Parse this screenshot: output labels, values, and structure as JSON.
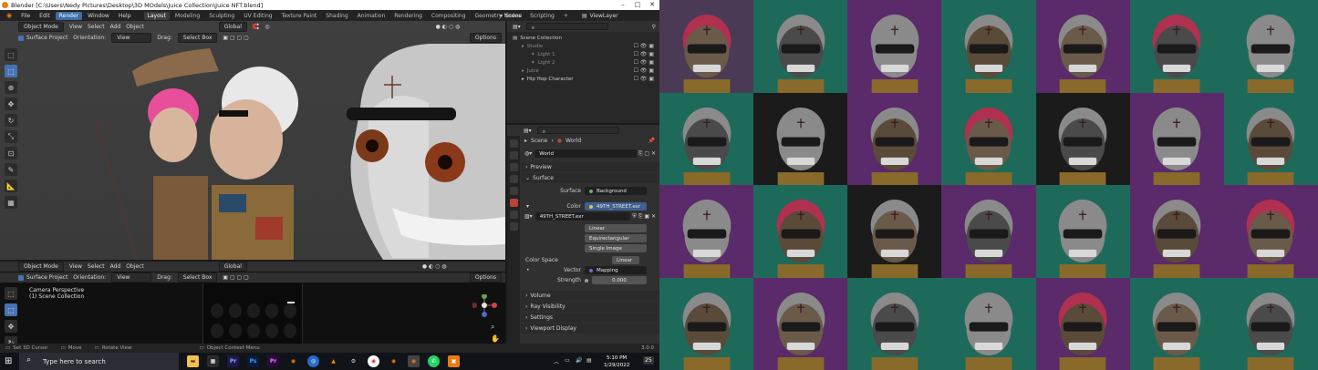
{
  "window": {
    "title": "Blender [C:\\Users\\Nedy Pictures\\Desktop\\3D MOdels\\Juice Collection\\Juice NFT.blend]"
  },
  "menubar": {
    "menus": [
      "File",
      "Edit",
      "Render",
      "Window",
      "Help"
    ],
    "active_menu": "Render",
    "workspaces": [
      "Layout",
      "Modeling",
      "Sculpting",
      "UV Editing",
      "Texture Paint",
      "Shading",
      "Animation",
      "Rendering",
      "Compositing",
      "Geometry Nodes",
      "Scripting"
    ],
    "active_workspace": "Layout",
    "scene_label": "Scene",
    "view_layer_label": "ViewLayer"
  },
  "viewport_top": {
    "mode": "Object Mode",
    "menus": [
      "View",
      "Select",
      "Add",
      "Object"
    ],
    "transform": "Global",
    "options": "Options",
    "surface_project": "Surface Project",
    "orientation_label": "Orientation:",
    "orientation_value": "View",
    "drag_label": "Drag:",
    "drag_value": "Select Box"
  },
  "viewport_bottom": {
    "mode": "Object Mode",
    "menus": [
      "View",
      "Select",
      "Add",
      "Object"
    ],
    "transform": "Global",
    "options": "Options",
    "surface_project": "Surface Project",
    "orientation_label": "Orientation:",
    "orientation_value": "View",
    "drag_label": "Drag:",
    "drag_value": "Select Box",
    "camera_label": "Camera Perspective",
    "collection_label": "(1) Scene Collection"
  },
  "outliner": {
    "items": [
      {
        "label": "Scene Collection",
        "indent": 0,
        "dim": false
      },
      {
        "label": "Studio",
        "indent": 1,
        "dim": true
      },
      {
        "label": "Light 1",
        "indent": 2,
        "dim": true
      },
      {
        "label": "Light 2",
        "indent": 2,
        "dim": true
      },
      {
        "label": "Juice",
        "indent": 1,
        "dim": true
      },
      {
        "label": "Hip Hop Character",
        "indent": 1,
        "dim": false
      }
    ]
  },
  "properties": {
    "breadcrumb_scene": "Scene",
    "breadcrumb_world": "World",
    "world_name": "World",
    "sections": {
      "preview": "Preview",
      "surface": "Surface",
      "volume": "Volume",
      "ray_visibility": "Ray Visibility",
      "settings": "Settings",
      "viewport_display": "Viewport Display"
    },
    "surface_label": "Surface",
    "surface_value": "Background",
    "color_label": "Color",
    "color_value": "49TH_STREET.exr",
    "image_name": "49TH_STREET.exr",
    "interpolation": "Linear",
    "projection": "Equirectangular",
    "source": "Single Image",
    "color_space_label": "Color Space",
    "color_space_value": "Linear",
    "vector_label": "Vector",
    "vector_value": "Mapping",
    "strength_label": "Strength",
    "strength_value": "0.000"
  },
  "statusbar": {
    "set_cursor": "Set 3D Cursor",
    "move": "Move",
    "rotate": "Rotate View",
    "context": "Object Context Menu",
    "version": "3.0.0"
  },
  "taskbar": {
    "search_placeholder": "Type here to search",
    "time": "5:10 PM",
    "date": "1/29/2022",
    "notification_count": "25"
  },
  "colors": {
    "accent": "#4772b3",
    "menu_active": "#3d6ea8",
    "blender_orange": "#e87d0d",
    "gallery_purple": "#5e2a6b",
    "gallery_teal": "#1f6b5c",
    "gallery_dark": "#1b1b1b"
  },
  "gallery": {
    "bg_pattern": [
      [
        "#4a3a55",
        "#1e6a5a",
        "#5a2a6a",
        "#1e6a5a",
        "#5a2a6a",
        "#1e6a5a",
        "#1e6a5a"
      ],
      [
        "#1e6a5a",
        "#1b1b1b",
        "#5a2a6a",
        "#1e6a5a",
        "#1b1b1b",
        "#5a2a6a",
        "#1e6a5a"
      ],
      [
        "#5a2a6a",
        "#1e6a5a",
        "#1b1b1b",
        "#5a2a6a",
        "#1e6a5a",
        "#5a2a6a",
        "#5a2a6a"
      ],
      [
        "#1e6a5a",
        "#5a2a6a",
        "#1e6a5a",
        "#1e6a5a",
        "#5a2a6a",
        "#1e6a5a",
        "#1e6a5a"
      ]
    ]
  }
}
